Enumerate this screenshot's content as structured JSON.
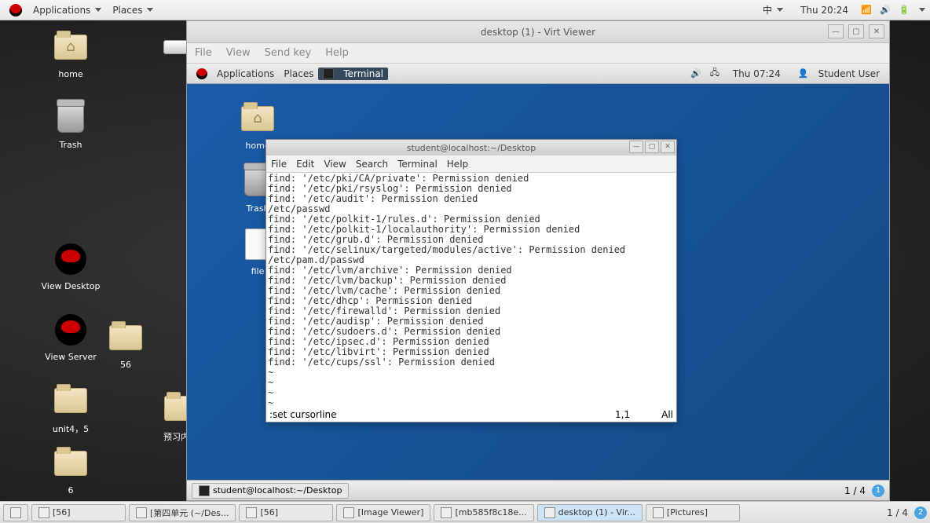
{
  "host_panel": {
    "apps_label": "Applications",
    "places_label": "Places",
    "ime": "中",
    "clock": "Thu 20:24"
  },
  "host_icons": {
    "home": "home",
    "trash": "Trash",
    "view_desktop": "View Desktop",
    "view_server": "View Server",
    "folder_56": "56",
    "unit45": "unit4，5",
    "preview": "预习内容",
    "folder_6": "6"
  },
  "virt": {
    "title": "desktop (1) - Virt Viewer",
    "menu": {
      "file": "File",
      "view": "View",
      "sendkey": "Send key",
      "help": "Help"
    }
  },
  "guest_panel": {
    "apps_label": "Applications",
    "places_label": "Places",
    "terminal_title": "Terminal",
    "clock": "Thu 07:24",
    "user": "Student User"
  },
  "guest_icons": {
    "home": "home",
    "trash": "Trash",
    "file": "file"
  },
  "guest_taskbar": {
    "item": "student@localhost:~/Desktop",
    "workspace": "1 / 4",
    "ws_badge": "1"
  },
  "terminal": {
    "title": "student@localhost:~/Desktop",
    "menu": {
      "file": "File",
      "edit": "Edit",
      "view": "View",
      "search": "Search",
      "terminal": "Terminal",
      "help": "Help"
    },
    "lines": [
      "find: '/etc/pki/CA/private': Permission denied",
      "find: '/etc/pki/rsyslog': Permission denied",
      "find: '/etc/audit': Permission denied",
      "/etc/passwd",
      "find: '/etc/polkit-1/rules.d': Permission denied",
      "find: '/etc/polkit-1/localauthority': Permission denied",
      "find: '/etc/grub.d': Permission denied",
      "find: '/etc/selinux/targeted/modules/active': Permission denied",
      "/etc/pam.d/passwd",
      "find: '/etc/lvm/archive': Permission denied",
      "find: '/etc/lvm/backup': Permission denied",
      "find: '/etc/lvm/cache': Permission denied",
      "find: '/etc/dhcp': Permission denied",
      "find: '/etc/firewalld': Permission denied",
      "find: '/etc/audisp': Permission denied",
      "find: '/etc/sudoers.d': Permission denied",
      "find: '/etc/ipsec.d': Permission denied",
      "find: '/etc/libvirt': Permission denied",
      "find: '/etc/cups/ssl': Permission denied",
      "~",
      "~",
      "~",
      "~"
    ],
    "status_cmd": ":set cursorline",
    "status_pos": "1,1",
    "status_pct": "All"
  },
  "host_taskbar": {
    "items": [
      "[56]",
      "[第四单元 (~/Des...",
      "[56]",
      "[Image Viewer]",
      "[mb585f8c18e...",
      "desktop (1) - Vir...",
      "[Pictures]"
    ],
    "workspace": "1 / 4",
    "ws_badge": "2"
  }
}
